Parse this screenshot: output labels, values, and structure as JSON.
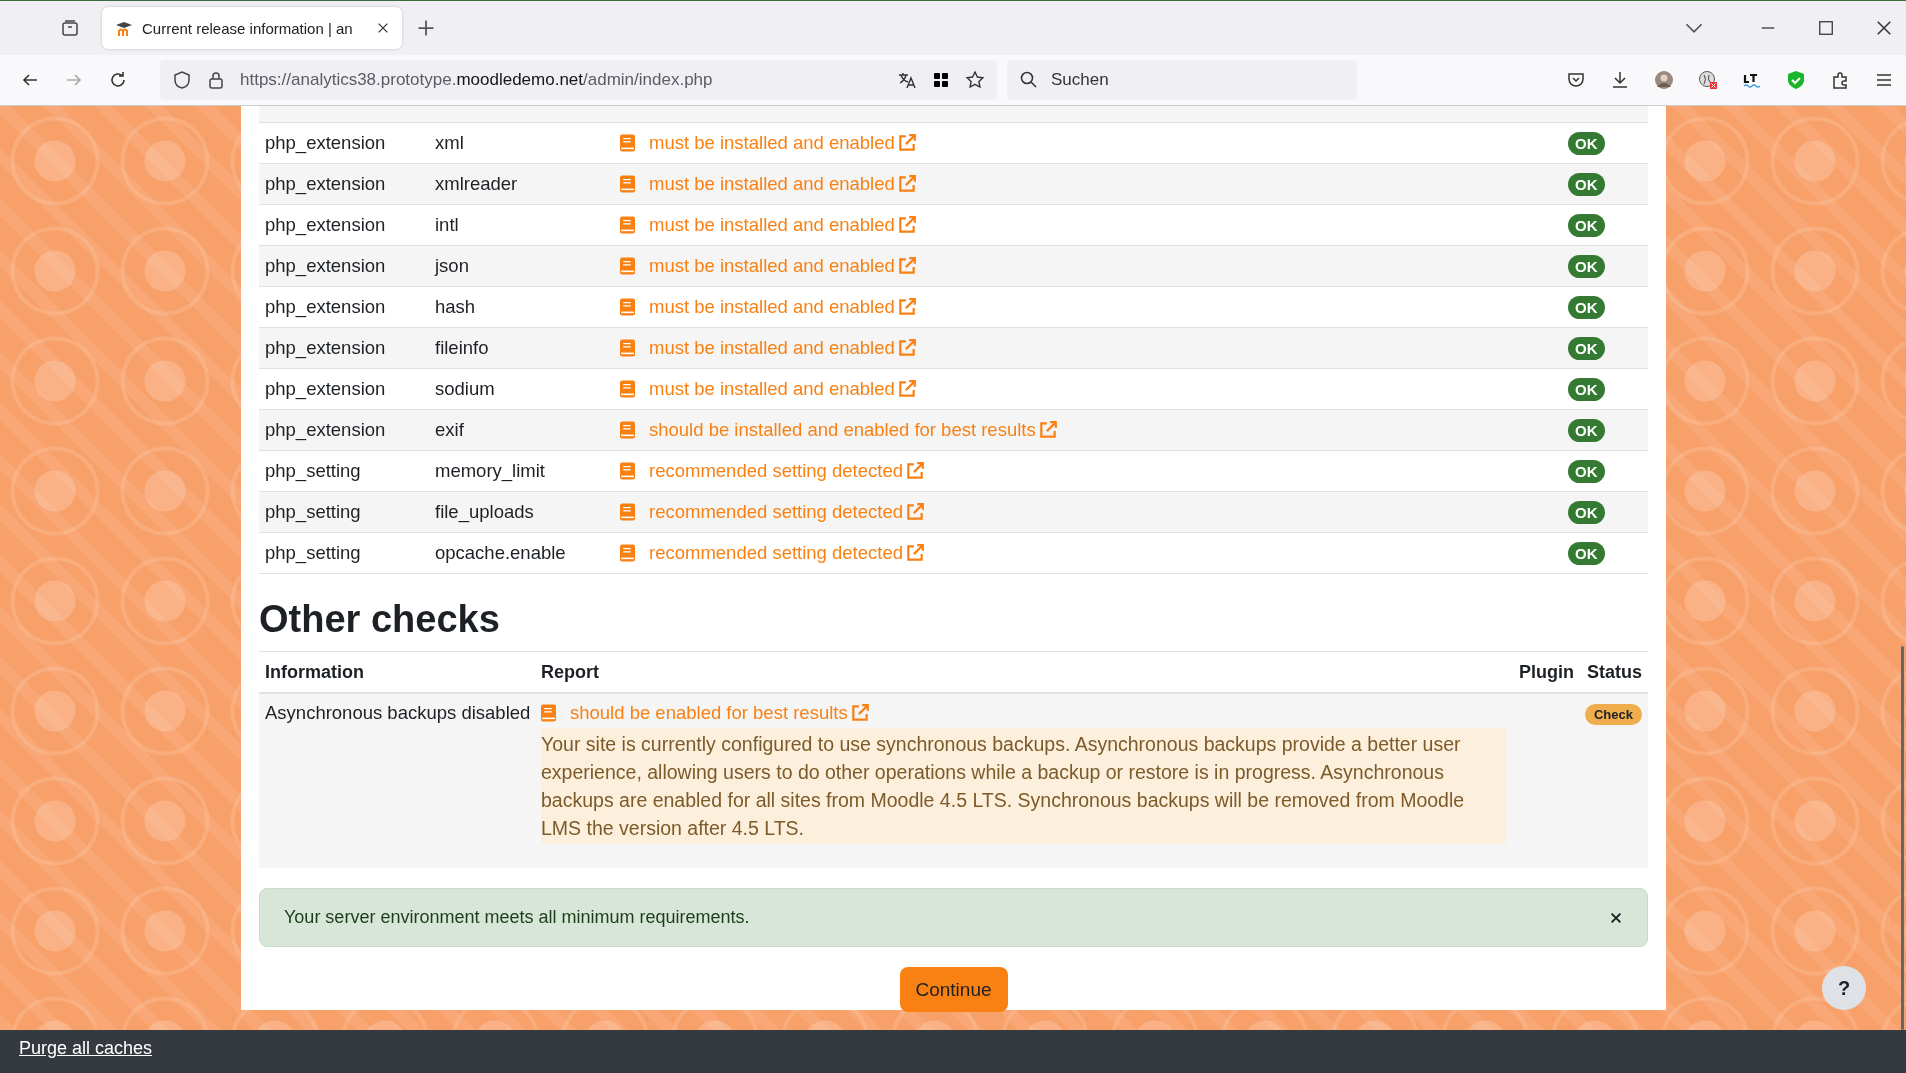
{
  "browser": {
    "tab_title": "Current release information | an",
    "address": {
      "prefix": "https://analytics38.prototype.",
      "domain": "moodledemo.net",
      "path": "/admin/index.php"
    },
    "search_placeholder": "Suchen"
  },
  "environment_rows": [
    {
      "type": "php_extension",
      "name": "xml",
      "report": "must be installed and enabled",
      "status": {
        "text": "OK",
        "kind": "success"
      }
    },
    {
      "type": "php_extension",
      "name": "xmlreader",
      "report": "must be installed and enabled",
      "status": {
        "text": "OK",
        "kind": "success"
      }
    },
    {
      "type": "php_extension",
      "name": "intl",
      "report": "must be installed and enabled",
      "status": {
        "text": "OK",
        "kind": "success"
      }
    },
    {
      "type": "php_extension",
      "name": "json",
      "report": "must be installed and enabled",
      "status": {
        "text": "OK",
        "kind": "success"
      }
    },
    {
      "type": "php_extension",
      "name": "hash",
      "report": "must be installed and enabled",
      "status": {
        "text": "OK",
        "kind": "success"
      }
    },
    {
      "type": "php_extension",
      "name": "fileinfo",
      "report": "must be installed and enabled",
      "status": {
        "text": "OK",
        "kind": "success"
      }
    },
    {
      "type": "php_extension",
      "name": "sodium",
      "report": "must be installed and enabled",
      "status": {
        "text": "OK",
        "kind": "success"
      }
    },
    {
      "type": "php_extension",
      "name": "exif",
      "report": "should be installed and enabled for best results",
      "status": {
        "text": "OK",
        "kind": "success"
      }
    },
    {
      "type": "php_setting",
      "name": "memory_limit",
      "report": "recommended setting detected",
      "status": {
        "text": "OK",
        "kind": "success"
      }
    },
    {
      "type": "php_setting",
      "name": "file_uploads",
      "report": "recommended setting detected",
      "status": {
        "text": "OK",
        "kind": "success"
      }
    },
    {
      "type": "php_setting",
      "name": "opcache.enable",
      "report": "recommended setting detected",
      "status": {
        "text": "OK",
        "kind": "success"
      }
    }
  ],
  "other_checks": {
    "title": "Other checks",
    "columns": [
      "Information",
      "Report",
      "Plugin",
      "Status"
    ],
    "rows": [
      {
        "information": "Asynchronous backups disabled",
        "report": "should be enabled for best results",
        "details": "Your site is currently configured to use synchronous backups. Asynchronous backups provide a better user experience, allowing users to do other operations while a backup or restore is in progress. Asynchronous backups are enabled for all sites from Moodle 4.5 LTS. Synchronous backups will be removed from Moodle LMS the version after 4.5 LTS.",
        "status": {
          "text": "Check",
          "kind": "warning"
        }
      }
    ]
  },
  "alert": {
    "text": "Your server environment meets all minimum requirements."
  },
  "continue_button": "Continue",
  "help_button": "?",
  "footer": {
    "link": "Purge all caches"
  }
}
